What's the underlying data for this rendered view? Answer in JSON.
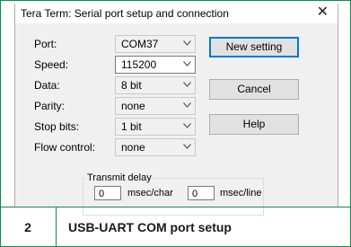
{
  "window": {
    "title": "Tera Term: Serial port setup and connection",
    "close_glyph": "✕"
  },
  "fields": [
    {
      "label": "Port:",
      "value": "COM37"
    },
    {
      "label": "Speed:",
      "value": "115200"
    },
    {
      "label": "Data:",
      "value": "8 bit"
    },
    {
      "label": "Parity:",
      "value": "none"
    },
    {
      "label": "Stop bits:",
      "value": "1 bit"
    },
    {
      "label": "Flow control:",
      "value": "none"
    }
  ],
  "buttons": {
    "new_setting": "New setting",
    "cancel": "Cancel",
    "help": "Help"
  },
  "transmit_delay": {
    "label": "Transmit delay",
    "char_value": "0",
    "char_unit": "msec/char",
    "line_value": "0",
    "line_unit": "msec/line"
  },
  "caption": {
    "number": "2",
    "text": "USB-UART COM port setup"
  },
  "colors": {
    "accent_green": "#138a4f",
    "button_default_border": "#0078d7"
  }
}
